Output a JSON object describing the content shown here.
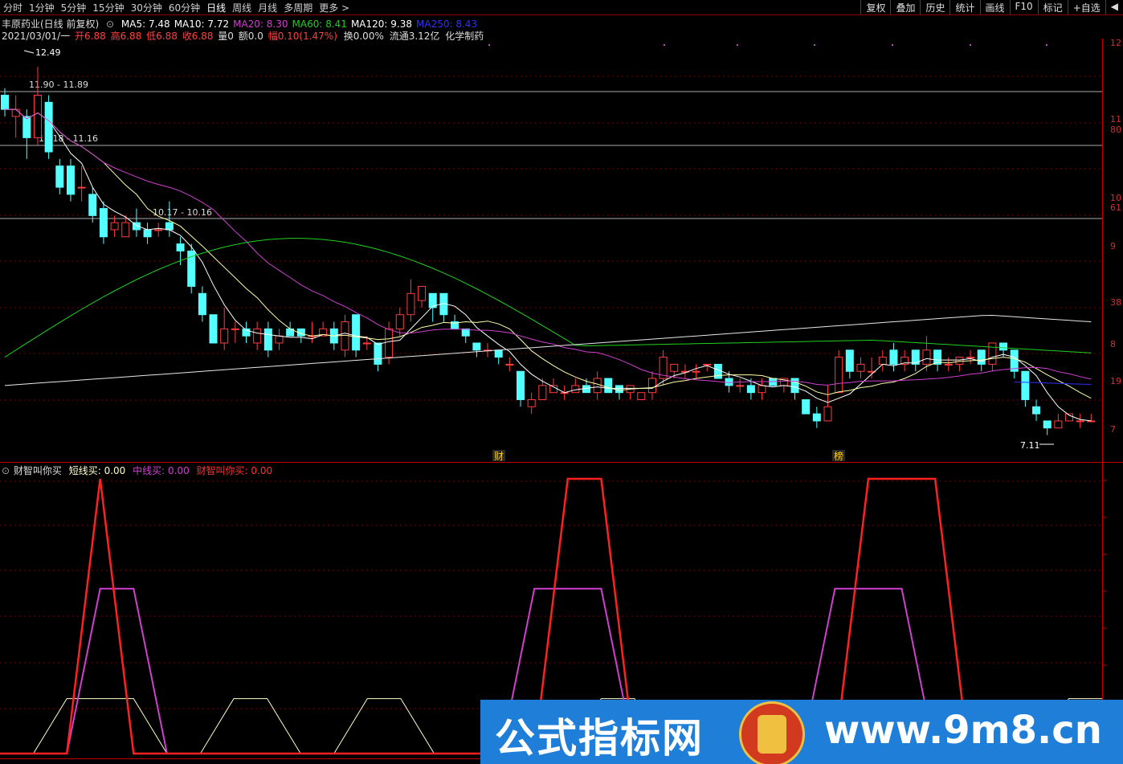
{
  "toolbar": {
    "periods": [
      "分时",
      "1分钟",
      "5分钟",
      "15分钟",
      "30分钟",
      "60分钟",
      "日线",
      "周线",
      "月线",
      "多周期",
      "更多 >"
    ],
    "active_period": "日线",
    "right_buttons": [
      "复权",
      "叠加",
      "历史",
      "统计",
      "画线",
      "F10",
      "标记",
      "+自选",
      "◀"
    ]
  },
  "header": {
    "stock": "丰原药业(日线 前复权)",
    "ma_labels": [
      {
        "text": "MA5: 7.48",
        "color": "#ffffff"
      },
      {
        "text": "MA10: 7.72",
        "color": "#ffffff"
      },
      {
        "text": "MA20: 8.30",
        "color": "#d040d0"
      },
      {
        "text": "MA60: 8.41",
        "color": "#20d020"
      },
      {
        "text": "MA120: 9.38",
        "color": "#ffffff"
      },
      {
        "text": "MA250: 8.43",
        "color": "#3030ff"
      }
    ]
  },
  "quote": {
    "date": "2021/03/01/一",
    "open": "开6.88",
    "high": "高6.88",
    "low": "低6.88",
    "close": "收6.88",
    "vol": "量0",
    "amount": "额0.0",
    "change": "幅0.10(1.47%)",
    "turnover": "换0.00%",
    "float": "流通3.12亿",
    "sector": "化学制药"
  },
  "price_markers": {
    "top": "12.49",
    "bottom": "7.11",
    "zones": [
      "11.90 - 11.89",
      "11.18 - 11.16",
      "10.17 - 10.16"
    ]
  },
  "right_axis_labels": [
    "12",
    "11",
    "80",
    "10",
    "61",
    "9",
    "38",
    "8",
    "19",
    "7"
  ],
  "event_markers": [
    "财",
    "榜"
  ],
  "indicator": {
    "name": "财智叫你买",
    "short_label": "短线买: 0.00",
    "mid_label": "中线买: 0.00",
    "main_label": "财智叫你买: 0.00",
    "colors": {
      "short": "#ffffcc",
      "mid": "#d040d0",
      "main": "#ff2020"
    }
  },
  "watermark": {
    "cn": "公式指标网",
    "url": "www.9m8.cn"
  },
  "chart_data": {
    "type": "candlestick",
    "price_range": [
      6.8,
      12.7
    ],
    "candles": [
      [
        11.9,
        11.7,
        12.0,
        11.6
      ],
      [
        11.6,
        11.7,
        11.9,
        11.3
      ],
      [
        11.6,
        11.3,
        11.7,
        11.0
      ],
      [
        11.3,
        11.9,
        12.3,
        11.2
      ],
      [
        11.8,
        11.1,
        11.9,
        11.0
      ],
      [
        10.9,
        10.6,
        11.0,
        10.5
      ],
      [
        10.9,
        10.5,
        11.0,
        10.4
      ],
      [
        10.6,
        10.6,
        10.9,
        10.4
      ],
      [
        10.5,
        10.2,
        10.6,
        10.1
      ],
      [
        10.3,
        9.9,
        10.4,
        9.8
      ],
      [
        10.0,
        10.1,
        10.2,
        9.9
      ],
      [
        9.9,
        10.1,
        10.2,
        9.9
      ],
      [
        10.1,
        10.0,
        10.3,
        9.9
      ],
      [
        10.0,
        9.9,
        10.1,
        9.8
      ],
      [
        10.0,
        10.0,
        10.1,
        9.9
      ],
      [
        10.1,
        10.0,
        10.4,
        9.9
      ],
      [
        9.8,
        9.7,
        9.9,
        9.5
      ],
      [
        9.7,
        9.2,
        9.8,
        9.1
      ],
      [
        9.1,
        8.8,
        9.2,
        8.7
      ],
      [
        8.8,
        8.4,
        8.8,
        8.4
      ],
      [
        8.4,
        8.6,
        8.9,
        8.3
      ],
      [
        8.6,
        8.6,
        8.7,
        8.4
      ],
      [
        8.6,
        8.5,
        8.7,
        8.4
      ],
      [
        8.4,
        8.6,
        8.7,
        8.3
      ],
      [
        8.6,
        8.3,
        8.7,
        8.2
      ],
      [
        8.4,
        8.5,
        8.6,
        8.3
      ],
      [
        8.6,
        8.5,
        8.7,
        8.5
      ],
      [
        8.6,
        8.5,
        8.6,
        8.4
      ],
      [
        8.5,
        8.5,
        8.7,
        8.4
      ],
      [
        8.5,
        8.6,
        8.7,
        8.5
      ],
      [
        8.6,
        8.4,
        8.7,
        8.3
      ],
      [
        8.3,
        8.7,
        8.8,
        8.2
      ],
      [
        8.8,
        8.3,
        8.8,
        8.2
      ],
      [
        8.4,
        8.4,
        8.5,
        8.3
      ],
      [
        8.4,
        8.1,
        8.4,
        8.0
      ],
      [
        8.2,
        8.6,
        8.7,
        8.1
      ],
      [
        8.6,
        8.8,
        8.9,
        8.5
      ],
      [
        8.8,
        9.1,
        9.3,
        8.7
      ],
      [
        9.0,
        9.2,
        9.2,
        8.9
      ],
      [
        9.1,
        8.9,
        9.1,
        8.7
      ],
      [
        9.1,
        8.8,
        9.1,
        8.7
      ],
      [
        8.7,
        8.6,
        8.8,
        8.6
      ],
      [
        8.6,
        8.5,
        8.6,
        8.4
      ],
      [
        8.4,
        8.3,
        8.4,
        8.2
      ],
      [
        8.3,
        8.3,
        8.4,
        8.2
      ],
      [
        8.3,
        8.2,
        8.3,
        8.1
      ],
      [
        8.1,
        8.1,
        8.2,
        8.0
      ],
      [
        8.0,
        7.6,
        8.0,
        7.5
      ],
      [
        7.5,
        7.6,
        7.7,
        7.4
      ],
      [
        7.6,
        7.8,
        7.9,
        7.6
      ],
      [
        7.7,
        7.8,
        7.9,
        7.7
      ],
      [
        7.7,
        7.7,
        7.8,
        7.6
      ],
      [
        7.7,
        7.8,
        7.9,
        7.7
      ],
      [
        7.8,
        7.7,
        7.9,
        7.7
      ],
      [
        7.7,
        7.9,
        8.0,
        7.6
      ],
      [
        7.9,
        7.7,
        7.9,
        7.7
      ],
      [
        7.8,
        7.7,
        7.8,
        7.6
      ],
      [
        7.7,
        7.8,
        7.8,
        7.6
      ],
      [
        7.6,
        7.7,
        7.7,
        7.6
      ],
      [
        7.7,
        7.9,
        8.0,
        7.6
      ],
      [
        7.9,
        8.2,
        8.3,
        7.8
      ],
      [
        8.0,
        8.1,
        8.1,
        7.9
      ],
      [
        8.0,
        8.0,
        8.1,
        7.9
      ],
      [
        8.0,
        8.0,
        8.1,
        7.9
      ],
      [
        8.1,
        8.1,
        8.1,
        8.0
      ],
      [
        8.1,
        7.9,
        8.1,
        7.9
      ],
      [
        7.9,
        7.8,
        8.0,
        7.7
      ],
      [
        7.8,
        7.8,
        7.9,
        7.7
      ],
      [
        7.8,
        7.7,
        7.9,
        7.6
      ],
      [
        7.7,
        7.8,
        7.9,
        7.6
      ],
      [
        7.9,
        7.8,
        7.9,
        7.8
      ],
      [
        7.8,
        7.9,
        7.9,
        7.7
      ],
      [
        7.9,
        7.7,
        7.9,
        7.6
      ],
      [
        7.6,
        7.4,
        7.6,
        7.4
      ],
      [
        7.4,
        7.3,
        7.5,
        7.2
      ],
      [
        7.3,
        7.5,
        7.8,
        7.3
      ],
      [
        7.7,
        8.2,
        8.3,
        7.7
      ],
      [
        8.3,
        8.0,
        8.3,
        7.9
      ],
      [
        8.0,
        8.1,
        8.2,
        7.9
      ],
      [
        8.0,
        8.0,
        8.2,
        7.9
      ],
      [
        8.1,
        8.2,
        8.3,
        8.0
      ],
      [
        8.3,
        8.1,
        8.4,
        8.0
      ],
      [
        8.1,
        8.2,
        8.3,
        8.0
      ],
      [
        8.3,
        8.1,
        8.3,
        8.0
      ],
      [
        8.1,
        8.3,
        8.5,
        8.0
      ],
      [
        8.3,
        8.1,
        8.3,
        8.0
      ],
      [
        8.1,
        8.1,
        8.2,
        8.0
      ],
      [
        8.1,
        8.2,
        8.2,
        8.0
      ],
      [
        8.2,
        8.2,
        8.3,
        8.1
      ],
      [
        8.3,
        8.1,
        8.3,
        8.0
      ],
      [
        8.1,
        8.4,
        8.4,
        8.0
      ],
      [
        8.4,
        8.3,
        8.4,
        8.2
      ],
      [
        8.3,
        8.0,
        8.3,
        7.9
      ],
      [
        8.0,
        7.6,
        8.0,
        7.5
      ],
      [
        7.5,
        7.4,
        7.6,
        7.3
      ],
      [
        7.3,
        7.2,
        7.3,
        7.1
      ],
      [
        7.2,
        7.3,
        7.4,
        7.2
      ],
      [
        7.3,
        7.4,
        7.4,
        7.3
      ],
      [
        7.3,
        7.3,
        7.4,
        7.2
      ],
      [
        7.3,
        7.3,
        7.4,
        7.3
      ]
    ],
    "indicator_series": {
      "short": [
        0,
        0,
        1,
        1,
        1,
        0,
        0,
        1,
        1,
        0,
        0,
        1,
        1,
        0,
        0,
        0,
        0,
        0,
        1,
        1,
        0,
        0,
        0,
        0,
        0,
        0,
        0,
        0,
        0,
        0,
        0,
        0,
        1,
        1
      ],
      "mid": [
        0,
        0,
        0,
        3,
        3,
        0,
        0,
        0,
        0,
        0,
        0,
        0,
        0,
        0,
        0,
        0,
        3,
        3,
        3,
        0,
        0,
        0,
        0,
        0,
        0,
        3,
        3,
        3,
        0,
        0,
        0,
        0,
        0,
        0
      ],
      "main": [
        0,
        0,
        0,
        5,
        0,
        0,
        0,
        0,
        0,
        0,
        0,
        0,
        0,
        0,
        0,
        0,
        0,
        5,
        5,
        0,
        0,
        0,
        0,
        0,
        0,
        0,
        5,
        5,
        5,
        0,
        0,
        0,
        0,
        0
      ]
    }
  }
}
